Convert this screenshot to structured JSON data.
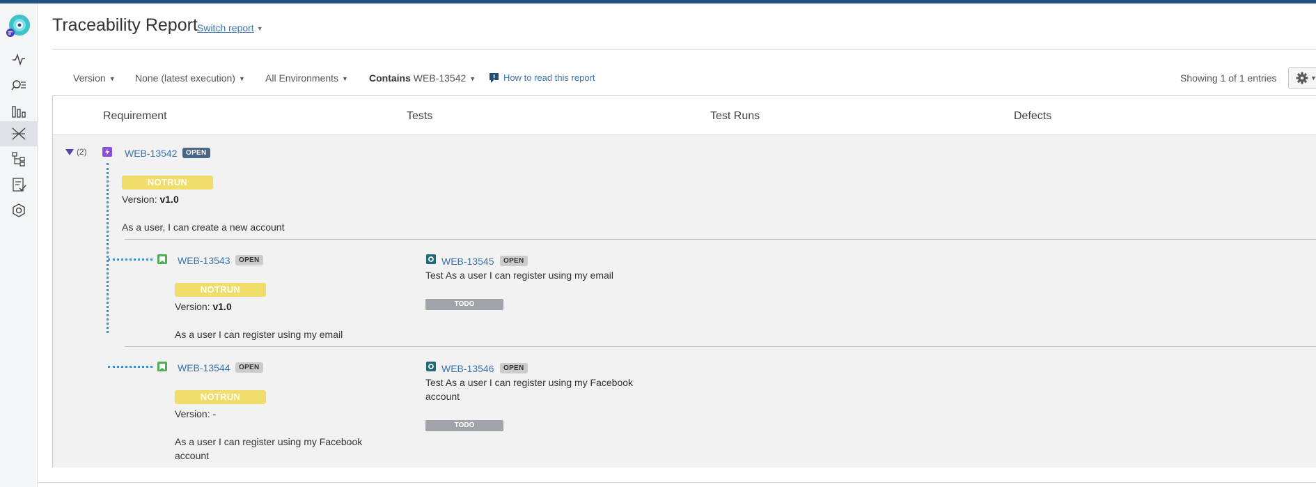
{
  "page": {
    "title": "Traceability Report",
    "switch_report": "Switch report"
  },
  "filters": {
    "version": "Version",
    "execution": "None (latest execution)",
    "environments": "All Environments",
    "contains_label": "Contains",
    "contains_value": "WEB-13542",
    "how_to": "How to read this report",
    "showing": "Showing 1 of 1 entries"
  },
  "table": {
    "headers": [
      "Requirement",
      "Tests",
      "Test Runs",
      "Defects"
    ],
    "expander_count": "(2)",
    "requirement": {
      "key": "WEB-13542",
      "status": "OPEN",
      "coverage": "NOTRUN",
      "version_label": "Version:",
      "version_value": "v1.0",
      "summary": "As a user, I can create a new account"
    },
    "children": [
      {
        "key": "WEB-13543",
        "status": "OPEN",
        "coverage": "NOTRUN",
        "version_label": "Version:",
        "version_value": "v1.0",
        "summary": "As a user I can register using my email",
        "test": {
          "key": "WEB-13545",
          "status": "OPEN",
          "summary": "Test As a user I can register using my email",
          "run_status": "TODO"
        }
      },
      {
        "key": "WEB-13544",
        "status": "OPEN",
        "coverage": "NOTRUN",
        "version_label": "Version:",
        "version_value": "-",
        "summary_line1": "As a user I can register using my Facebook",
        "summary_line2": "account",
        "test": {
          "key": "WEB-13546",
          "status": "OPEN",
          "summary_line1": "Test As a user I can register using my Facebook",
          "summary_line2": "account",
          "run_status": "TODO"
        }
      }
    ]
  },
  "sidebar": {
    "icons": [
      "app-logo-icon",
      "activity-icon",
      "search-list-icon",
      "bar-chart-icon",
      "traceability-icon",
      "hierarchy-icon",
      "test-plan-icon",
      "settings-hex-icon"
    ]
  },
  "colors": {
    "topbar": "#205081",
    "link": "#3b73af",
    "notrun": "#f0dd6a",
    "todo": "#a0a4aa",
    "lozenge_dark": "#4a6785",
    "dotted_line": "#3a8fd8"
  }
}
